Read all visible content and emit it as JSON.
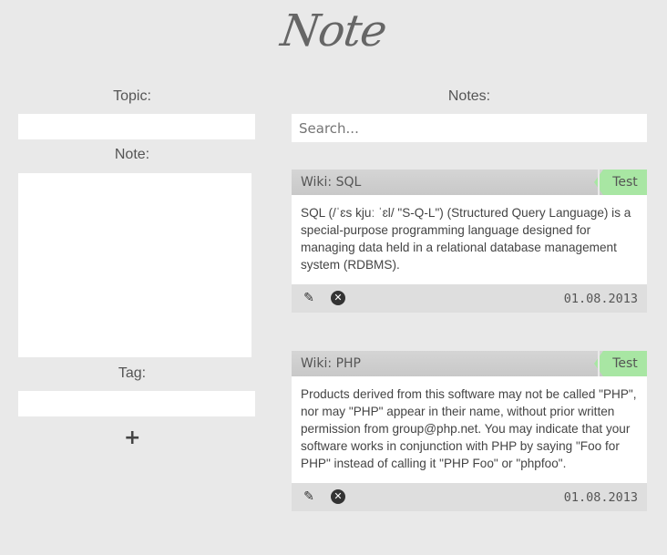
{
  "app": {
    "logo": "Note"
  },
  "form": {
    "topic_label": "Topic:",
    "topic_value": "",
    "note_label": "Note:",
    "note_value": "",
    "tag_label": "Tag:",
    "tag_value": "",
    "add_icon": "plus-icon"
  },
  "notes_panel": {
    "label": "Notes:",
    "search_placeholder": "Search..."
  },
  "notes": [
    {
      "title": "Wiki: SQL",
      "tag": "Test",
      "body": "SQL (/ˈɛs kjuː ˈɛl/ \"S-Q-L\") (Structured Query Language) is a special-purpose programming language designed for managing data held in a relational database management system (RDBMS).",
      "date": "01.08.2013",
      "edit_icon": "pencil-icon",
      "delete_icon": "close-circle-icon"
    },
    {
      "title": "Wiki: PHP",
      "tag": "Test",
      "body": "Products derived from this software may not be called \"PHP\", nor may \"PHP\" appear in their name, without prior written permission from group@php.net. You may indicate that your software works in conjunction with PHP by saying \"Foo for PHP\" instead of calling it \"PHP Foo\" or \"phpfoo\".",
      "date": "01.08.2013",
      "edit_icon": "pencil-icon",
      "delete_icon": "close-circle-icon"
    }
  ],
  "colors": {
    "background": "#e9e9e9",
    "card_header": "#cfcfcf",
    "tag": "#a8e6a3",
    "card_footer": "#dedede"
  }
}
